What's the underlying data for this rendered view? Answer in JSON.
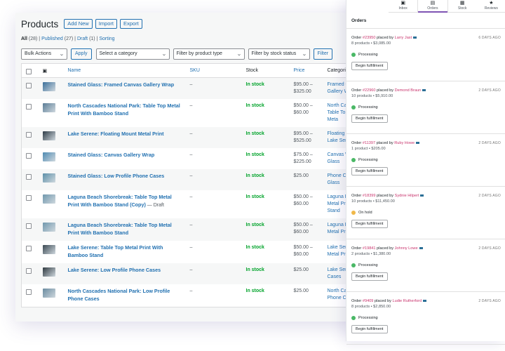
{
  "products": {
    "title": "Products",
    "buttons": [
      "Add New",
      "Import",
      "Export"
    ],
    "subsub": {
      "all": "All",
      "all_count": "(28)",
      "published": "Published",
      "published_count": "(27)",
      "draft": "Draft",
      "draft_count": "(1)",
      "sorting": "Sorting"
    },
    "filters": {
      "bulk": "Bulk Actions",
      "apply": "Apply",
      "category": "Select a category",
      "type": "Filter by product type",
      "stock": "Filter by stock status",
      "filter": "Filter"
    },
    "columns": {
      "name": "Name",
      "sku": "SKU",
      "stock": "Stock",
      "price": "Price",
      "categories": "Categori"
    },
    "rows": [
      {
        "name": "Stained Glass: Framed Canvas Gallery Wrap",
        "draft": "",
        "sku": "–",
        "stock": "In stock",
        "price1": "$95.00 –",
        "price2": "$325.00",
        "cat1": "Framed C",
        "cat2": "Gallery W",
        "thumb": "#3b6f9a"
      },
      {
        "name": "North Cascades National Park: Table Top Metal Print With Bamboo Stand",
        "draft": "",
        "sku": "–",
        "stock": "In stock",
        "price1": "$50.00 –",
        "price2": "$60.00",
        "cat1": "North Ca",
        "cat2": "Table Top",
        "cat3": "Meta",
        "thumb": "#5a7c96"
      },
      {
        "name": "Lake Serene: Floating Mount Metal Print",
        "draft": "",
        "sku": "–",
        "stock": "In stock",
        "price1": "$95.00 –",
        "price2": "$525.00",
        "cat1": "Floating I",
        "cat2": "Lake Sere",
        "thumb": "#2e3b46"
      },
      {
        "name": "Stained Glass: Canvas Gallery Wrap",
        "draft": "",
        "sku": "–",
        "stock": "In stock",
        "price1": "$75.00 –",
        "price2": "$225.00",
        "cat1": "Canvas W",
        "cat2": "Glass",
        "thumb": "#4e8ab2"
      },
      {
        "name": "Stained Glass: Low Profile Phone Cases",
        "draft": "",
        "sku": "–",
        "stock": "In stock",
        "price1": "$25.00",
        "price2": "",
        "cat1": "Phone Ca",
        "cat2": "Glass",
        "thumb": "#5c8fa8"
      },
      {
        "name": "Laguna Beach Shorebreak: Table Top Metal Print With Bamboo Stand (Copy)",
        "draft": " — Draft",
        "sku": "–",
        "stock": "In stock",
        "price1": "$50.00 –",
        "price2": "$60.00",
        "cat1": "Laguna B",
        "cat2": "Metal Pri",
        "cat3": "Stand",
        "thumb": "#6f97ad"
      },
      {
        "name": "Laguna Beach Shorebreak: Table Top Metal Print With Bamboo Stand",
        "draft": "",
        "sku": "–",
        "stock": "In stock",
        "price1": "$50.00 –",
        "price2": "$60.00",
        "cat1": "Laguna B",
        "cat2": "Metal Pri",
        "thumb": "#6f97ad"
      },
      {
        "name": "Lake Serene: Table Top Metal Print With Bamboo Stand",
        "draft": "",
        "sku": "–",
        "stock": "In stock",
        "price1": "$50.00 –",
        "price2": "$60.00",
        "cat1": "Lake Sere",
        "cat2": "Metal Pri",
        "thumb": "#3a4852"
      },
      {
        "name": "Lake Serene: Low Profile Phone Cases",
        "draft": "",
        "sku": "–",
        "stock": "In stock",
        "price1": "$25.00",
        "price2": "",
        "cat1": "Lake Sere",
        "cat2": "Cases",
        "thumb": "#2f3940"
      },
      {
        "name": "North Cascades National Park: Low Profile Phone Cases",
        "draft": "",
        "sku": "–",
        "stock": "In stock",
        "price1": "$25.00",
        "price2": "",
        "cat1": "North Ca",
        "cat2": "Phone Ca",
        "thumb": "#6a8ba0"
      }
    ]
  },
  "orders_panel": {
    "tabs": [
      {
        "label": "Inbox",
        "icon": "inbox-icon",
        "glyph": "▣"
      },
      {
        "label": "Orders",
        "icon": "orders-icon",
        "glyph": "▤"
      },
      {
        "label": "Stock",
        "icon": "stock-icon",
        "glyph": "▦"
      },
      {
        "label": "Reviews",
        "icon": "reviews-icon",
        "glyph": "★"
      }
    ],
    "title": "Orders",
    "orders": [
      {
        "prefix": "Order ",
        "number": "#23950",
        "placed": " placed by ",
        "customer": "Larry Jast",
        "date": "6 DAYS AGO",
        "summary": "8 products • $3,085.00",
        "status": "Processing",
        "status_color": "#4ab866",
        "button": "Begin fulfillment"
      },
      {
        "prefix": "Order ",
        "number": "#22960",
        "placed": " placed by ",
        "customer": "Demond Braun",
        "date": "2 DAYS AGO",
        "summary": "10 products • $5,910.00",
        "status": "Processing",
        "status_color": "#4ab866",
        "button": "Begin fulfillment"
      },
      {
        "prefix": "Order ",
        "number": "#11397",
        "placed": " placed by ",
        "customer": "Ruby Howe",
        "date": "2 DAYS AGO",
        "summary": "1 product • $205.00",
        "status": "Processing",
        "status_color": "#4ab866",
        "button": "Begin fulfillment"
      },
      {
        "prefix": "Order ",
        "number": "#18399",
        "placed": " placed by ",
        "customer": "Sydnie Hilpert",
        "date": "2 DAYS AGO",
        "summary": "10 products • $11,450.00",
        "status": "On hold",
        "status_color": "#f0b849",
        "button": "Begin fulfillment"
      },
      {
        "prefix": "Order ",
        "number": "#19841",
        "placed": " placed by ",
        "customer": "Johnny Lowe",
        "date": "2 DAYS AGO",
        "summary": "2 products • $1,380.00",
        "status": "Processing",
        "status_color": "#4ab866",
        "button": "Begin fulfillment"
      },
      {
        "prefix": "Order ",
        "number": "#9409",
        "placed": " placed by ",
        "customer": "Ludie Rutherford",
        "date": "2 DAYS AGO",
        "summary": "8 products • $2,850.00",
        "status": "Processing",
        "status_color": "#4ab866",
        "button": "Begin fulfillment"
      }
    ]
  }
}
